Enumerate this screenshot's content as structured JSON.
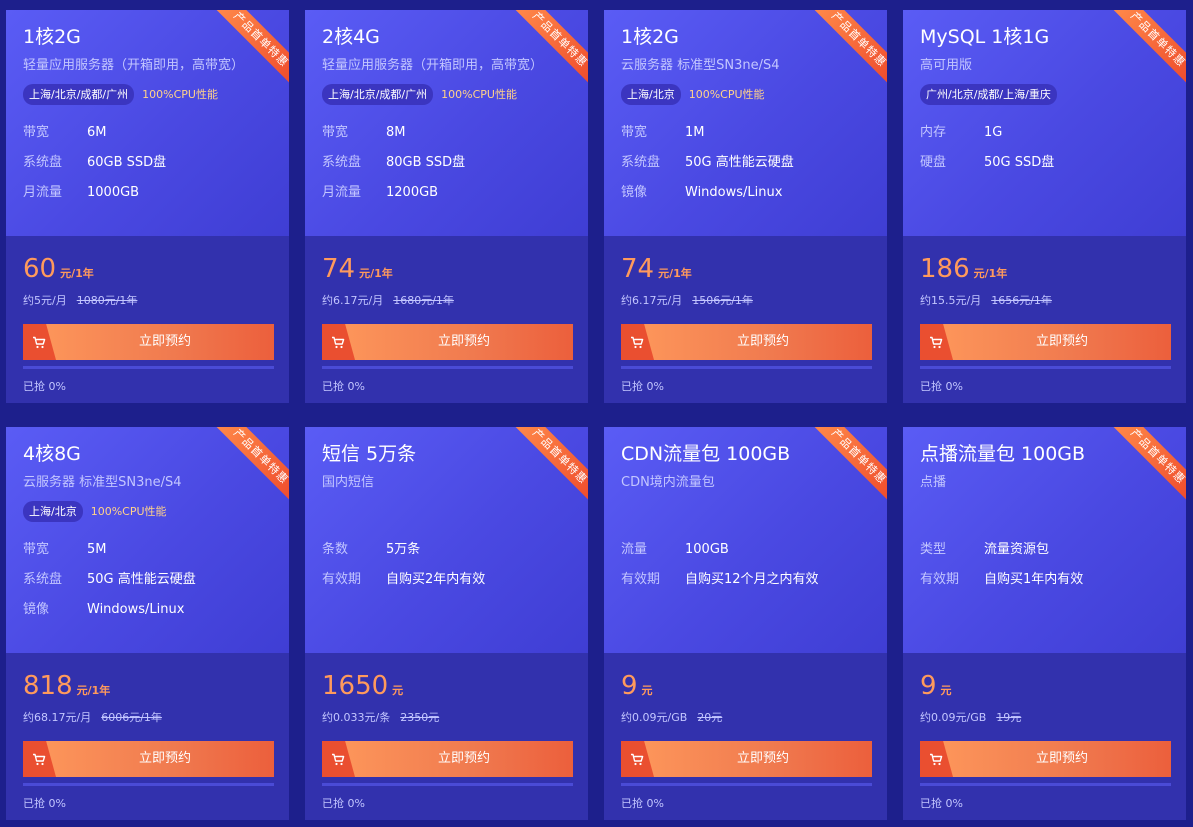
{
  "ribbon_text": "产品首单特惠",
  "buy_label": "立即预约",
  "cards": [
    {
      "title": "1核2G",
      "subtitle": "轻量应用服务器（开箱即用，高带宽）",
      "region": "上海/北京/成都/广州",
      "cpu": "100%CPU性能",
      "specs": [
        {
          "label": "带宽",
          "value": "6M"
        },
        {
          "label": "系统盘",
          "value": "60GB SSD盘"
        },
        {
          "label": "月流量",
          "value": "1000GB"
        }
      ],
      "price": "60",
      "unit": "元/1年",
      "approx": "约5元/月",
      "original": "1080元/1年",
      "sold": "已抢 0%",
      "sold_fraction": 0
    },
    {
      "title": "2核4G",
      "subtitle": "轻量应用服务器（开箱即用，高带宽）",
      "region": "上海/北京/成都/广州",
      "cpu": "100%CPU性能",
      "specs": [
        {
          "label": "带宽",
          "value": "8M"
        },
        {
          "label": "系统盘",
          "value": "80GB SSD盘"
        },
        {
          "label": "月流量",
          "value": "1200GB"
        }
      ],
      "price": "74",
      "unit": "元/1年",
      "approx": "约6.17元/月",
      "original": "1680元/1年",
      "sold": "已抢 0%",
      "sold_fraction": 0
    },
    {
      "title": "1核2G",
      "subtitle": "云服务器 标准型SN3ne/S4",
      "region": "上海/北京",
      "cpu": "100%CPU性能",
      "specs": [
        {
          "label": "带宽",
          "value": "1M"
        },
        {
          "label": "系统盘",
          "value": "50G 高性能云硬盘"
        },
        {
          "label": "镜像",
          "value": "Windows/Linux"
        }
      ],
      "price": "74",
      "unit": "元/1年",
      "approx": "约6.17元/月",
      "original": "1506元/1年",
      "sold": "已抢 0%",
      "sold_fraction": 0
    },
    {
      "title": "MySQL 1核1G",
      "subtitle": "高可用版",
      "region": "广州/北京/成都/上海/重庆",
      "cpu": "",
      "specs": [
        {
          "label": "内存",
          "value": "1G"
        },
        {
          "label": "硬盘",
          "value": "50G SSD盘"
        }
      ],
      "price": "186",
      "unit": "元/1年",
      "approx": "约15.5元/月",
      "original": "1656元/1年",
      "sold": "已抢 0%",
      "sold_fraction": 0
    },
    {
      "title": "4核8G",
      "subtitle": "云服务器 标准型SN3ne/S4",
      "region": "上海/北京",
      "cpu": "100%CPU性能",
      "specs": [
        {
          "label": "带宽",
          "value": "5M"
        },
        {
          "label": "系统盘",
          "value": "50G 高性能云硬盘"
        },
        {
          "label": "镜像",
          "value": "Windows/Linux"
        }
      ],
      "price": "818",
      "unit": "元/1年",
      "approx": "约68.17元/月",
      "original": "6006元/1年",
      "sold": "已抢 0%",
      "sold_fraction": 0
    },
    {
      "title": "短信 5万条",
      "subtitle": "国内短信",
      "region": "",
      "cpu": "",
      "specs": [
        {
          "label": "条数",
          "value": "5万条"
        },
        {
          "label": "有效期",
          "value": "自购买2年内有效"
        }
      ],
      "price": "1650",
      "unit": "元",
      "approx": "约0.033元/条",
      "original": "2350元",
      "sold": "已抢 0%",
      "sold_fraction": 0
    },
    {
      "title": "CDN流量包 100GB",
      "subtitle": "CDN境内流量包",
      "region": "",
      "cpu": "",
      "specs": [
        {
          "label": "流量",
          "value": "100GB"
        },
        {
          "label": "有效期",
          "value": "自购买12个月之内有效"
        }
      ],
      "price": "9",
      "unit": "元",
      "approx": "约0.09元/GB",
      "original": "20元",
      "sold": "已抢 0%",
      "sold_fraction": 0
    },
    {
      "title": "点播流量包 100GB",
      "subtitle": "点播",
      "region": "",
      "cpu": "",
      "specs": [
        {
          "label": "类型",
          "value": "流量资源包"
        },
        {
          "label": "有效期",
          "value": "自购买1年内有效"
        }
      ],
      "price": "9",
      "unit": "元",
      "approx": "约0.09元/GB",
      "original": "19元",
      "sold": "已抢 0%",
      "sold_fraction": 0
    }
  ]
}
